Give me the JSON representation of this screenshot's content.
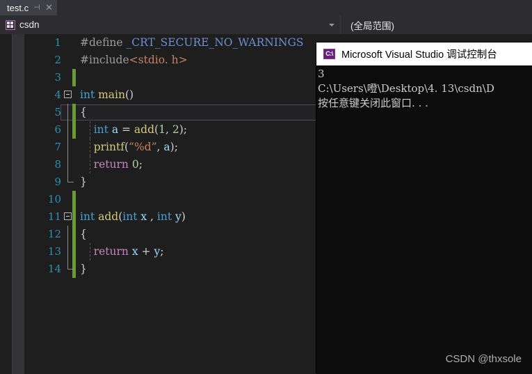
{
  "tab": {
    "title": "test.c",
    "pin_icon": "pin-icon",
    "close_icon": "close-icon"
  },
  "nav_bar": {
    "project_icon": "project-icon",
    "project": "csdn",
    "dropdown_icon": "chevron-down-icon",
    "scope": "(全局范围)"
  },
  "editor": {
    "lines": [
      {
        "n": "1",
        "change": false,
        "outline": false,
        "guide": false,
        "current": false,
        "tokens": [
          {
            "t": "#define ",
            "c": "t-pre"
          },
          {
            "t": "_CRT_SECURE_NO_WARNINGS",
            "c": "t-macro"
          }
        ]
      },
      {
        "n": "2",
        "change": false,
        "outline": false,
        "guide": false,
        "current": false,
        "tokens": [
          {
            "t": "#include",
            "c": "t-pre"
          },
          {
            "t": "<stdio. h>",
            "c": "t-inc"
          }
        ]
      },
      {
        "n": "3",
        "change": true,
        "outline": false,
        "guide": false,
        "current": false,
        "tokens": []
      },
      {
        "n": "4",
        "change": false,
        "outline": true,
        "guide": false,
        "current": false,
        "tokens": [
          {
            "t": "int ",
            "c": "t-kw"
          },
          {
            "t": "main",
            "c": "t-fn"
          },
          {
            "t": "()",
            "c": "t-plain"
          }
        ]
      },
      {
        "n": "5",
        "change": true,
        "outline": false,
        "brace": true,
        "guide": false,
        "current": true,
        "tokens": [
          {
            "t": "{",
            "c": "t-plain"
          }
        ]
      },
      {
        "n": "6",
        "change": true,
        "outline": false,
        "brace": true,
        "guide": true,
        "current": false,
        "tokens": [
          {
            "t": "    ",
            "c": "t-plain"
          },
          {
            "t": "int ",
            "c": "t-kw"
          },
          {
            "t": "a",
            "c": "t-var"
          },
          {
            "t": " = ",
            "c": "t-plain"
          },
          {
            "t": "add",
            "c": "t-fn"
          },
          {
            "t": "(",
            "c": "t-plain"
          },
          {
            "t": "1",
            "c": "t-num"
          },
          {
            "t": ", ",
            "c": "t-plain"
          },
          {
            "t": "2",
            "c": "t-num"
          },
          {
            "t": ");",
            "c": "t-plain"
          }
        ]
      },
      {
        "n": "7",
        "change": false,
        "outline": false,
        "brace": true,
        "guide": true,
        "current": false,
        "tokens": [
          {
            "t": "    ",
            "c": "t-plain"
          },
          {
            "t": "printf",
            "c": "t-fn"
          },
          {
            "t": "(",
            "c": "t-plain"
          },
          {
            "t": "“%d”",
            "c": "t-str"
          },
          {
            "t": ", ",
            "c": "t-plain"
          },
          {
            "t": "a",
            "c": "t-var"
          },
          {
            "t": ");",
            "c": "t-plain"
          }
        ]
      },
      {
        "n": "8",
        "change": false,
        "outline": false,
        "brace": true,
        "guide": true,
        "current": false,
        "tokens": [
          {
            "t": "    ",
            "c": "t-plain"
          },
          {
            "t": "return ",
            "c": "t-kw2"
          },
          {
            "t": "0",
            "c": "t-num"
          },
          {
            "t": ";",
            "c": "t-plain"
          }
        ]
      },
      {
        "n": "9",
        "change": false,
        "outline": false,
        "braceFoot": true,
        "guide": false,
        "current": false,
        "tokens": [
          {
            "t": "}",
            "c": "t-plain"
          }
        ]
      },
      {
        "n": "10",
        "change": true,
        "outline": false,
        "guide": false,
        "current": false,
        "tokens": []
      },
      {
        "n": "11",
        "change": true,
        "outline": true,
        "guide": false,
        "current": false,
        "tokens": [
          {
            "t": "int ",
            "c": "t-kw"
          },
          {
            "t": "add",
            "c": "t-fn"
          },
          {
            "t": "(",
            "c": "t-plain"
          },
          {
            "t": "int ",
            "c": "t-kw"
          },
          {
            "t": "x",
            "c": "t-var"
          },
          {
            "t": " , ",
            "c": "t-plain"
          },
          {
            "t": "int ",
            "c": "t-kw"
          },
          {
            "t": "y",
            "c": "t-var"
          },
          {
            "t": ")",
            "c": "t-plain"
          }
        ]
      },
      {
        "n": "12",
        "change": true,
        "outline": false,
        "brace": true,
        "guide": false,
        "current": false,
        "tokens": [
          {
            "t": "{",
            "c": "t-plain"
          }
        ]
      },
      {
        "n": "13",
        "change": true,
        "outline": false,
        "brace": true,
        "guide": true,
        "current": false,
        "tokens": [
          {
            "t": "    ",
            "c": "t-plain"
          },
          {
            "t": "return ",
            "c": "t-kw2"
          },
          {
            "t": "x",
            "c": "t-var"
          },
          {
            "t": " + ",
            "c": "t-plain"
          },
          {
            "t": "y",
            "c": "t-var"
          },
          {
            "t": ";",
            "c": "t-plain"
          }
        ]
      },
      {
        "n": "14",
        "change": true,
        "outline": false,
        "braceFoot": true,
        "guide": false,
        "current": false,
        "tokens": [
          {
            "t": "}",
            "c": "t-plain"
          }
        ]
      }
    ]
  },
  "console": {
    "app_icon": "console-app-icon",
    "icon_glyph": "C:\\",
    "title": "Microsoft Visual Studio 调试控制台",
    "output": [
      "3",
      "C:\\Users\\噔\\Desktop\\4. 13\\csdn\\D",
      "按任意键关闭此窗口. . ."
    ]
  },
  "watermark": "CSDN @thxsole",
  "colors": {
    "change_bar": "#6a9a36",
    "line_number": "#2b91af",
    "accent_purple": "#68217a",
    "editor_bg": "#1e1e1e",
    "chrome_bg": "#2d2d30",
    "console_bg": "#0c0c0c"
  }
}
